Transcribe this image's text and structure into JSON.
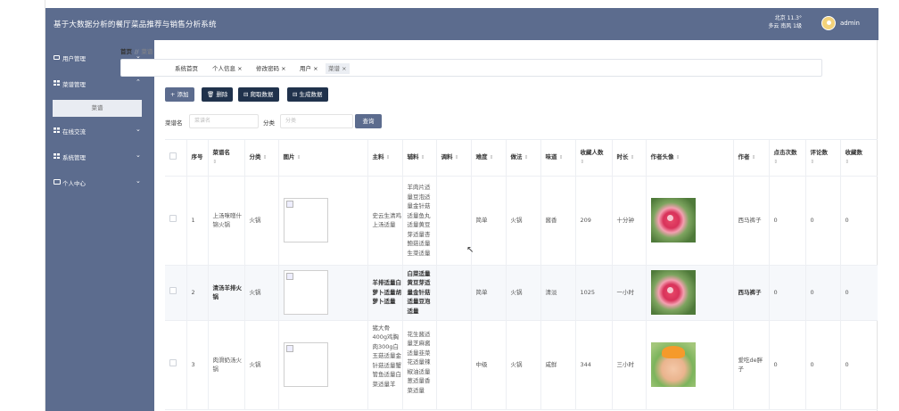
{
  "app": {
    "title": "基于大数据分析的餐厅菜品推荐与销售分析系统",
    "weather_line1": "北京 11.3°",
    "weather_line2": "多云 南风 1级",
    "user": "admin",
    "colors": {
      "header": "#5c6c8e",
      "sidebar": "#5c6c8e",
      "dark_button": "#20324c"
    }
  },
  "sidebar": {
    "items": [
      {
        "label": "用户管理",
        "icon": "user-card-icon",
        "chevron": "⌄"
      },
      {
        "label": "菜谱管理",
        "icon": "grid-icon",
        "chevron": "⌃"
      },
      {
        "label": "在线交流",
        "icon": "grid-icon",
        "chevron": "⌄"
      },
      {
        "label": "系统管理",
        "icon": "grid-icon",
        "chevron": "⌄"
      },
      {
        "label": "个人中心",
        "icon": "monitor-icon",
        "chevron": "⌄"
      }
    ],
    "sub_item": "菜谱"
  },
  "breadcrumb": {
    "home": "首页",
    "sep": "//",
    "current": "菜谱"
  },
  "tabs": [
    {
      "label": "系统首页"
    },
    {
      "label": "个人信息 ×"
    },
    {
      "label": "修改密码 ×"
    },
    {
      "label": "用户 ×"
    },
    {
      "label": "菜谱 ×"
    }
  ],
  "toolbar": {
    "add": "+ 添加",
    "delete": "🗑 删除",
    "crawl": "⊟ 爬取数据",
    "generate": "⊟ 生成数据"
  },
  "filters": {
    "name_label": "菜谱名",
    "name_placeholder": "菜谱名",
    "category_label": "分类",
    "category_placeholder": "分类",
    "query": "查询"
  },
  "table": {
    "headers": {
      "seq": "序号",
      "name": "菜谱名",
      "category": "分类",
      "image": "图片",
      "main": "主料",
      "aux": "辅料",
      "seasoning": "调料",
      "difficulty": "难度",
      "method": "做法",
      "taste": "味道",
      "favorites": "收藏人数",
      "duration": "时长",
      "avatar": "作者头像",
      "author": "作者",
      "clicks": "点击次数",
      "comments": "评论数",
      "collect": "收藏数"
    },
    "sort_glyph": "⇕",
    "rows": [
      {
        "seq": "1",
        "name": "上汤咪噌什锦火锅",
        "category": "火锅",
        "main": "史云生清鸡上汤适量",
        "aux": "羊肉片适量豆泡适量金针菇适量鱼丸适量黄豆芽适量杏鲍菇适量生菜适量",
        "seasoning": "",
        "difficulty": "简单",
        "method": "火锅",
        "taste": "酱香",
        "favorites": "209",
        "duration": "十分钟",
        "avatar": "flower",
        "author": "西马裤子",
        "clicks": "0",
        "comments": "0",
        "collect": "0"
      },
      {
        "seq": "2",
        "name": "清汤羊排火锅",
        "category": "火锅",
        "main": "羊排适量白萝卜适量胡萝卜适量",
        "aux": "白菜适量黄豆芽适量金针菇适量豆泡适量",
        "seasoning": "",
        "difficulty": "简单",
        "method": "火锅",
        "taste": "清淡",
        "favorites": "1025",
        "duration": "一小时",
        "avatar": "flower",
        "author": "西马裤子",
        "clicks": "0",
        "comments": "0",
        "collect": "0"
      },
      {
        "seq": "3",
        "name": "肉滑奶汤火锅",
        "category": "火锅",
        "main": "猪大骨400g鸡胸肉300g白玉菇适量金针菇适量蟹管鱼适量白菜适量羊",
        "aux": "花生酱适量芝麻酱适量韭菜花适量辣椒油适量葱适量香菜适量",
        "seasoning": "",
        "difficulty": "中级",
        "method": "火锅",
        "taste": "咸鲜",
        "favorites": "344",
        "duration": "三小时",
        "avatar": "baby",
        "author": "爱吃de胖子",
        "clicks": "0",
        "comments": "0",
        "collect": "0"
      }
    ]
  }
}
